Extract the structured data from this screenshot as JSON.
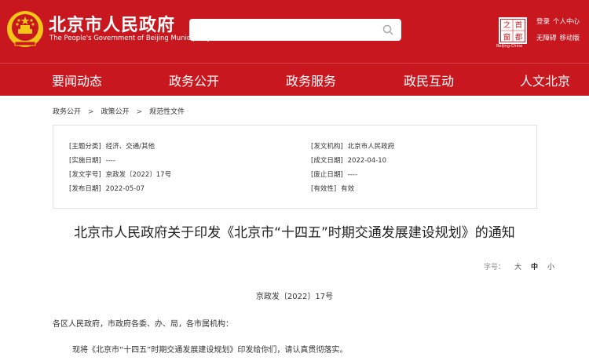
{
  "header": {
    "title": "北京市人民政府",
    "subtitle": "The People's Government of Beijing Municipality",
    "search_placeholder": "",
    "logo_chars": [
      "首",
      "都",
      "之",
      "窗"
    ],
    "logo_caption": "Beijing-China",
    "links_row1": [
      "登录",
      "个人中心"
    ],
    "links_row2": [
      "无障碍",
      "移动版"
    ]
  },
  "nav": [
    "要闻动态",
    "政务公开",
    "政务服务",
    "政民互动",
    "人文北京"
  ],
  "breadcrumb": [
    "政务公开",
    "政策公开",
    "规范性文件"
  ],
  "breadcrumb_sep": ">",
  "info": [
    {
      "label": "[主题分类]",
      "value": "经济、交通/其他"
    },
    {
      "label": "[发文机构]",
      "value": "北京市人民政府"
    },
    {
      "label": "[实施日期]",
      "value": "----"
    },
    {
      "label": "[成文日期]",
      "value": "2022-04-10"
    },
    {
      "label": "[发文字号]",
      "value": "京政发〔2022〕17号"
    },
    {
      "label": "[废止日期]",
      "value": "----"
    },
    {
      "label": "[发布日期]",
      "value": "2022-05-07"
    },
    {
      "label": "[有效性]",
      "value": "有效"
    }
  ],
  "doc": {
    "title": "北京市人民政府关于印发《北京市“十四五”时期交通发展建设规划》的通知",
    "font_label": "字号：",
    "font_sizes": [
      "大",
      "中",
      "小"
    ],
    "font_active": "中",
    "number": "京政发〔2022〕17号",
    "addressee": "各区人民政府，市政府各委、办、局，各市属机构：",
    "para1": "现将《北京市“十四五”时期交通发展建设规划》印发给你们，请认真贯彻落实。"
  },
  "colors": {
    "brand_red": "#c8171e",
    "gold": "#f5c518"
  }
}
